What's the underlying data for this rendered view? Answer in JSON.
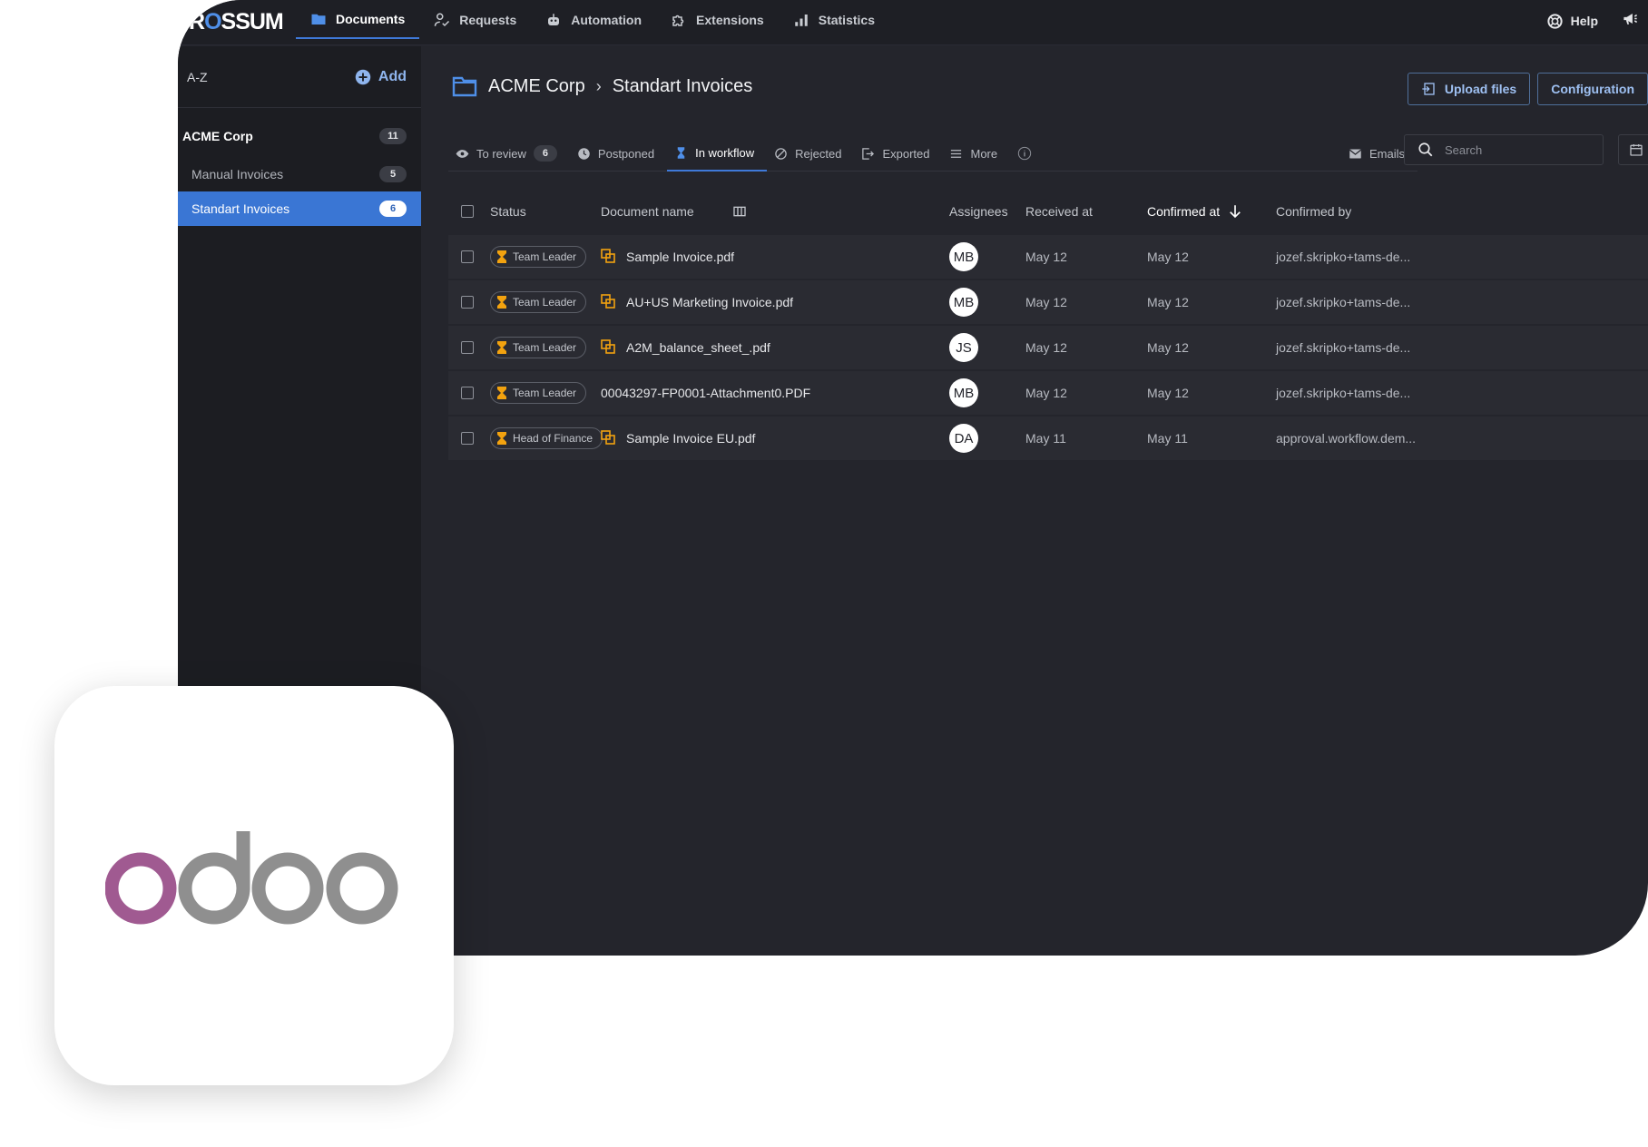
{
  "app": {
    "logo": "ROSSUM",
    "nav": [
      {
        "label": "Documents",
        "icon": "folder-icon",
        "active": true
      },
      {
        "label": "Requests",
        "icon": "person-check-icon"
      },
      {
        "label": "Automation",
        "icon": "robot-icon"
      },
      {
        "label": "Extensions",
        "icon": "puzzle-icon"
      },
      {
        "label": "Statistics",
        "icon": "bar-chart-icon"
      }
    ],
    "help_label": "Help"
  },
  "sidebar": {
    "sort_label": "A-Z",
    "add_label": "Add",
    "group": {
      "label": "ACME Corp",
      "count": "11"
    },
    "items": [
      {
        "label": "Manual Invoices",
        "count": "5",
        "active": false
      },
      {
        "label": "Standart Invoices",
        "count": "6",
        "active": true
      }
    ]
  },
  "main": {
    "breadcrumb": {
      "parent": "ACME Corp",
      "current": "Standart Invoices"
    },
    "actions": {
      "upload": "Upload files",
      "config": "Configuration"
    },
    "tabs": [
      {
        "label": "To review",
        "badge": "6"
      },
      {
        "label": "Postponed"
      },
      {
        "label": "In workflow",
        "active": true
      },
      {
        "label": "Rejected"
      },
      {
        "label": "Exported"
      },
      {
        "label": "More"
      }
    ],
    "emails_label": "Emails",
    "search_placeholder": "Search",
    "table": {
      "headers": {
        "status": "Status",
        "name": "Document name",
        "assignees": "Assignees",
        "received": "Received at",
        "confirmed": "Confirmed at",
        "confirmed_by": "Confirmed by"
      },
      "rows": [
        {
          "status": "Team Leader",
          "name": "Sample Invoice.pdf",
          "has_icon": true,
          "assignee": "MB",
          "received": "May 12",
          "confirmed": "May 12",
          "by": "jozef.skripko+tams-de..."
        },
        {
          "status": "Team Leader",
          "name": "AU+US Marketing Invoice.pdf",
          "has_icon": true,
          "assignee": "MB",
          "received": "May 12",
          "confirmed": "May 12",
          "by": "jozef.skripko+tams-de..."
        },
        {
          "status": "Team Leader",
          "name": "A2M_balance_sheet_.pdf",
          "has_icon": true,
          "assignee": "JS",
          "received": "May 12",
          "confirmed": "May 12",
          "by": "jozef.skripko+tams-de..."
        },
        {
          "status": "Team Leader",
          "name": "00043297-FP0001-Attachment0.PDF",
          "has_icon": false,
          "assignee": "MB",
          "received": "May 12",
          "confirmed": "May 12",
          "by": "jozef.skripko+tams-de..."
        },
        {
          "status": "Head of Finance",
          "name": "Sample Invoice EU.pdf",
          "has_icon": true,
          "assignee": "DA",
          "received": "May 11",
          "confirmed": "May 11",
          "by": "approval.workflow.dem..."
        }
      ]
    }
  },
  "colors": {
    "accent": "#3f79d8",
    "background": "#24252c",
    "sidebar": "#1c1d22",
    "hourglass": "#f2a20f",
    "odoo_purple": "#a05a91",
    "odoo_gray": "#8f8f8f"
  }
}
